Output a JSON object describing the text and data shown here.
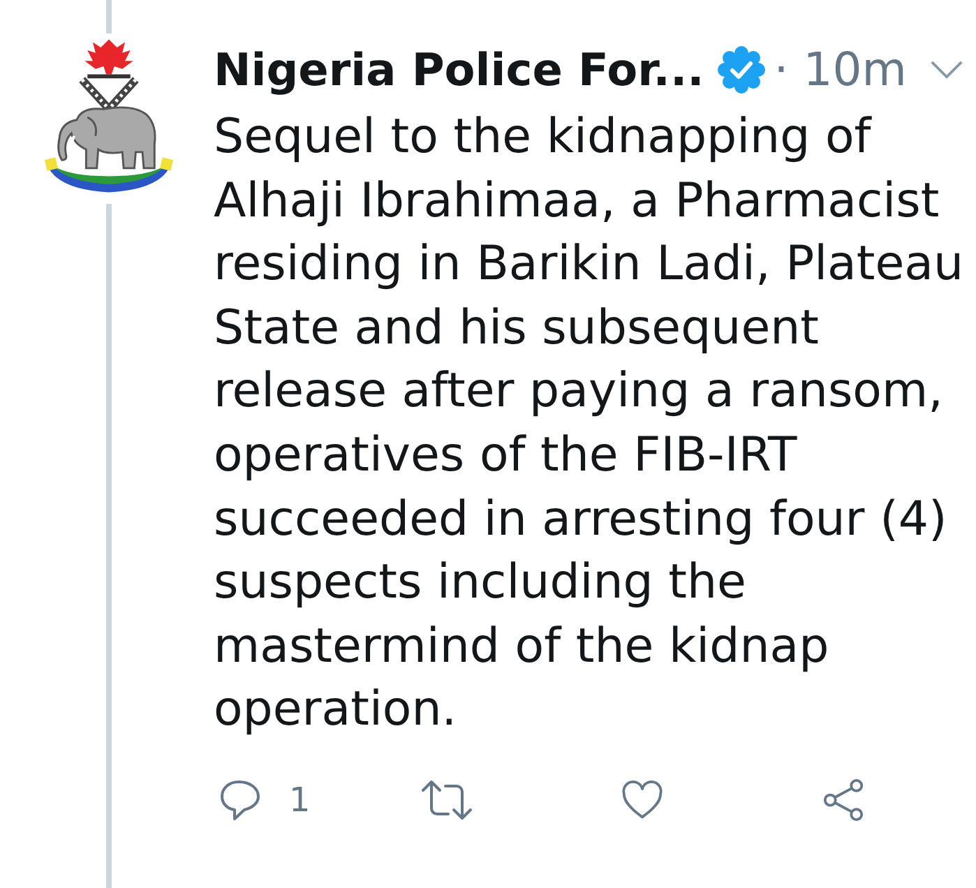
{
  "tweet": {
    "author": {
      "name": "Nigeria Police For...",
      "verified": true
    },
    "time": "· 10m",
    "text": "Sequel to the kidnapping of Alhaji Ibrahimaa, a Pharmacist residing in Barikin Ladi, Plateau State and his subsequent release after paying a ransom, operatives of the FIB-IRT succeeded in arresting four (4) suspects including the mastermind of the kidnap operation.",
    "actions": [
      {
        "kind": "reply",
        "count": "1"
      },
      {
        "kind": "retweet"
      },
      {
        "kind": "like"
      },
      {
        "kind": "share"
      }
    ]
  }
}
